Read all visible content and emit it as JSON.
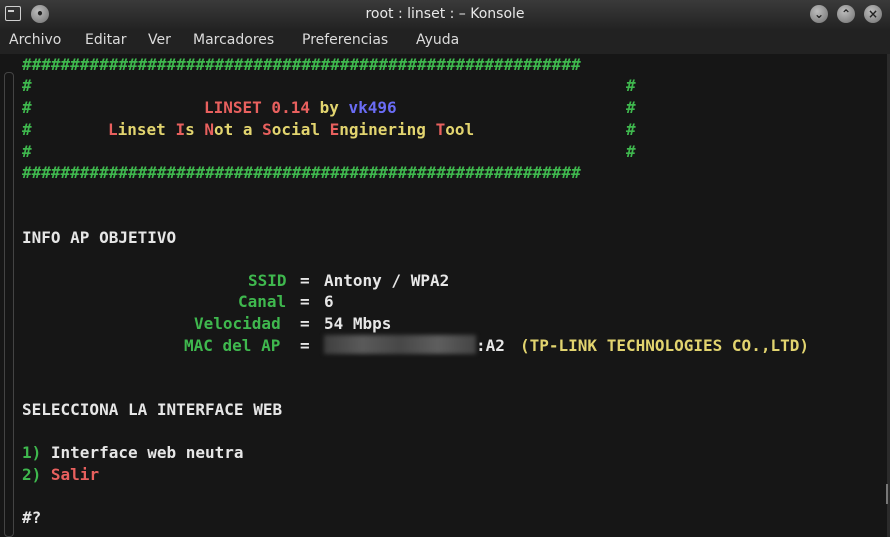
{
  "window": {
    "title": "root : linset : – Konsole",
    "controls": [
      "chevron-down-icon",
      "chevron-up-icon",
      "close-icon"
    ]
  },
  "menubar": [
    "Archivo",
    "Editar",
    "Ver",
    "Marcadores",
    "Preferencias",
    "Ayuda"
  ],
  "terminal": {
    "hash_border": "##########################################################",
    "hash": "#",
    "banner_title": "LINSET 0.14",
    "banner_by": "by",
    "banner_author": "vk496",
    "banner_tag_L": "L",
    "banner_tag_1": "inset ",
    "banner_tag_I": "I",
    "banner_tag_2": "s ",
    "banner_tag_N": "N",
    "banner_tag_3": "ot a ",
    "banner_tag_S": "S",
    "banner_tag_4": "ocial ",
    "banner_tag_E": "E",
    "banner_tag_5": "nginering ",
    "banner_tag_T": "T",
    "banner_tag_6": "ool",
    "info_heading": "INFO AP OBJETIVO",
    "ssid_label": "SSID",
    "ssid_value": "Antony / WPA2",
    "channel_label": "Canal",
    "channel_value": "6",
    "speed_label": "Velocidad",
    "speed_value": "54 Mbps",
    "mac_label": "MAC del AP",
    "mac_suffix": ":A2",
    "mac_vendor": "(TP-LINK TECHNOLOGIES CO.,LTD)",
    "equals": "=",
    "select_heading": "SELECCIONA LA INTERFACE WEB",
    "option1_num": "1)",
    "option1_label": "Interface web neutra",
    "option2_num": "2)",
    "option2_label": "Salir",
    "prompt": "#?"
  },
  "colors": {
    "green": "#3fb84e",
    "red": "#e8605e",
    "blue": "#6a6cf5",
    "yellow": "#e2d46f",
    "text": "#e6e6e6",
    "background": "#161616"
  }
}
